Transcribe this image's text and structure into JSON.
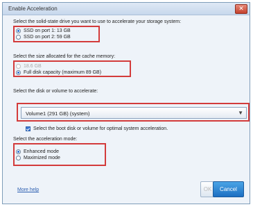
{
  "window": {
    "title": "Enable Acceleration",
    "close_glyph": "✕"
  },
  "drive_section": {
    "prompt": "Select the solid-state drive you want to use to accelerate your storage system:",
    "options": [
      {
        "label": "SSD on port 1: 13 GB",
        "selected": true
      },
      {
        "label": "SSD on port 2: 59 GB",
        "selected": false
      }
    ]
  },
  "size_section": {
    "prompt": "Select the size allocated for the cache memory:",
    "options": [
      {
        "label": "18.6 GB",
        "selected": false,
        "enabled": false
      },
      {
        "label": "Full disk capacity (maximum 89 GB)",
        "selected": true,
        "enabled": true
      }
    ]
  },
  "volume_section": {
    "prompt": "Select the disk or volume to accelerate:",
    "selected_value": "Volume1 (291 GB) (system)",
    "dropdown_glyph": "▼",
    "checkbox_label": "Select the boot disk or volume for optimal system acceleration.",
    "checkbox_checked": true
  },
  "mode_section": {
    "prompt": "Select the acceleration mode:",
    "options": [
      {
        "label": "Enhanced mode",
        "selected": true
      },
      {
        "label": "Maximized mode",
        "selected": false
      }
    ]
  },
  "footer": {
    "more_help": "More help",
    "ok_label": "OK",
    "cancel_label": "Cancel"
  },
  "colors": {
    "highlight_box": "#d33b3b",
    "cancel_button": "#1c6fc2"
  }
}
